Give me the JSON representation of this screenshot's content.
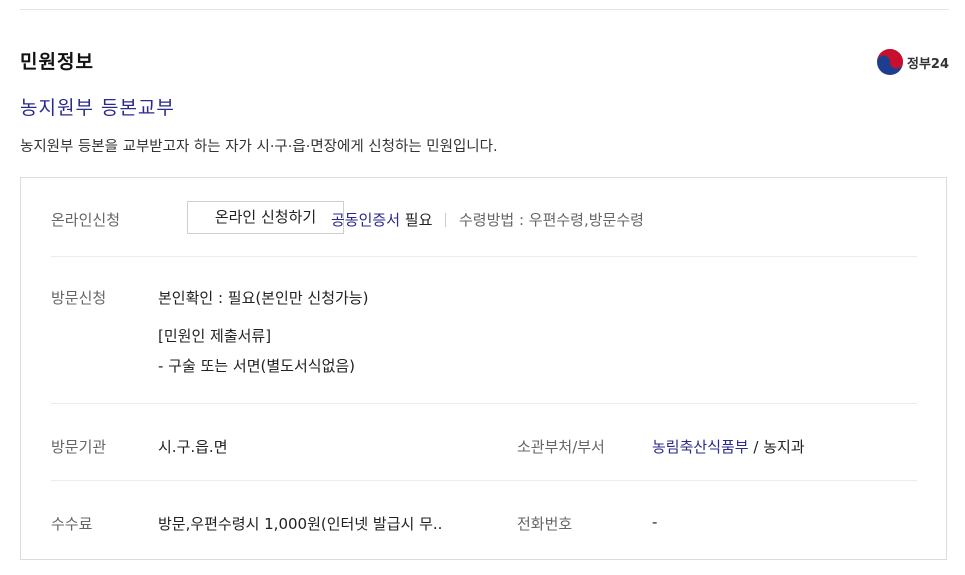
{
  "section": {
    "title": "민원정보"
  },
  "brand": {
    "text": "정부24"
  },
  "service": {
    "name": "농지원부 등본교부",
    "description": "농지원부 등본을 교부받고자 하는 자가 시·구·읍·면장에게 신청하는 민원입니다."
  },
  "online": {
    "label": "온라인신청",
    "button": "온라인 신청하기",
    "cert_link": "공동인증서",
    "cert_required": "필요",
    "receive_label": "수령방법",
    "receive_value": "우편수령,방문수령"
  },
  "visit": {
    "label": "방문신청",
    "id_check": "본인확인 : 필요(본인만 신청가능)",
    "docs_title": "[민원인 제출서류]",
    "docs_item": "- 구술 또는 서면(별도서식없음)"
  },
  "agency": {
    "label": "방문기관",
    "value": "시.구.읍.면",
    "dept_label": "소관부처/부서",
    "ministry": "농림축산식품부",
    "dept": "/ 농지과"
  },
  "fee": {
    "label": "수수료",
    "value": "방문,우편수령시 1,000원(인터넷 발급시 무..",
    "phone_label": "전화번호",
    "phone_value": "-"
  }
}
